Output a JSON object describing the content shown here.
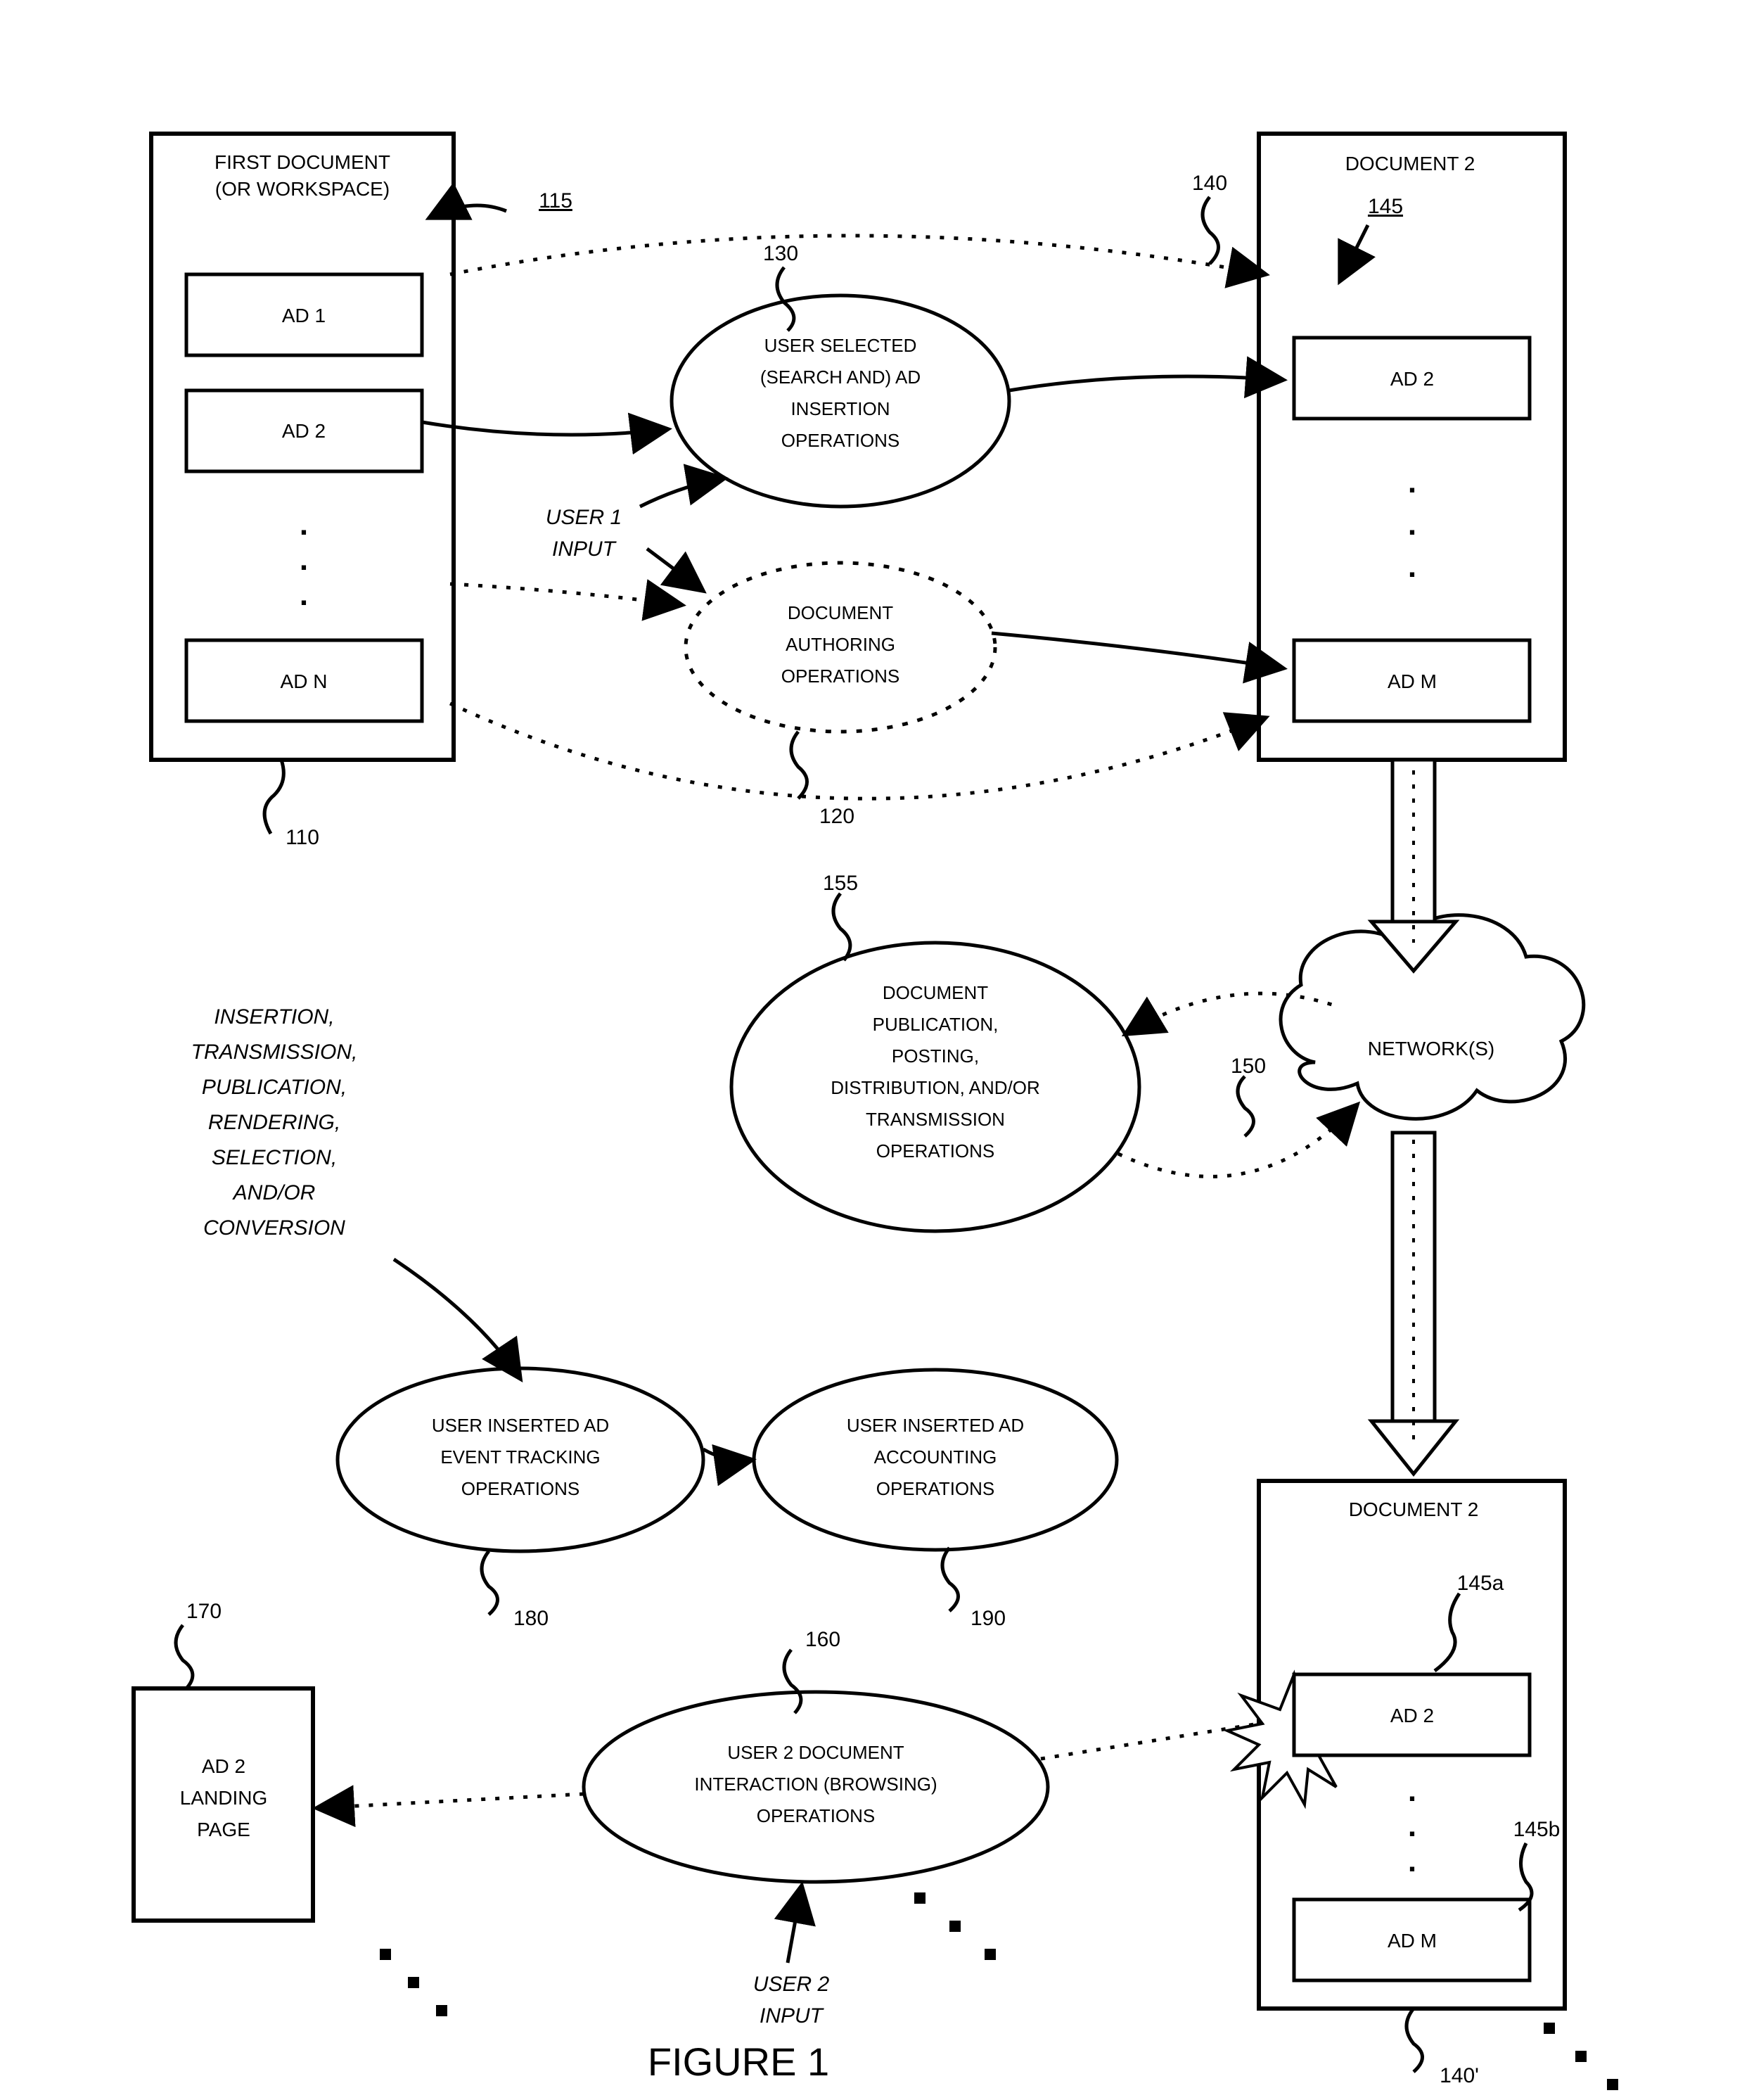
{
  "doc1": {
    "title1": "FIRST DOCUMENT",
    "title2": "(OR WORKSPACE)",
    "ad1": "AD 1",
    "ad2": "AD 2",
    "adn": "AD N",
    "ref": "110",
    "ref_inner": "115"
  },
  "doc2a": {
    "title": "DOCUMENT 2",
    "ad2": "AD 2",
    "adm": "AD M",
    "ref": "140",
    "ref_inner": "145"
  },
  "doc2b": {
    "title": "DOCUMENT 2",
    "ad2": "AD 2",
    "adm": "AD M",
    "ref": "140'",
    "ref_a": "145a",
    "ref_b": "145b"
  },
  "op_insert": {
    "l1": "USER SELECTED",
    "l2": "(SEARCH AND) AD",
    "l3": "INSERTION",
    "l4": "OPERATIONS",
    "ref": "130"
  },
  "op_author": {
    "l1": "DOCUMENT",
    "l2": "AUTHORING",
    "l3": "OPERATIONS",
    "ref": "120"
  },
  "op_pub": {
    "l1": "DOCUMENT",
    "l2": "PUBLICATION,",
    "l3": "POSTING,",
    "l4": "DISTRIBUTION,  AND/OR",
    "l5": "TRANSMISSION",
    "l6": "OPERATIONS",
    "ref": "155"
  },
  "op_track": {
    "l1": "USER INSERTED AD",
    "l2": "EVENT TRACKING",
    "l3": "OPERATIONS",
    "ref": "180"
  },
  "op_acct": {
    "l1": "USER INSERTED AD",
    "l2": "ACCOUNTING",
    "l3": "OPERATIONS",
    "ref": "190"
  },
  "op_browse": {
    "l1": "USER 2 DOCUMENT",
    "l2": "INTERACTION (BROWSING)",
    "l3": "OPERATIONS",
    "ref": "160"
  },
  "landing": {
    "l1": "AD 2",
    "l2": "LANDING",
    "l3": "PAGE",
    "ref": "170"
  },
  "network": {
    "label": "NETWORK(S)",
    "ref": "150"
  },
  "user1": "USER 1",
  "input": "INPUT",
  "user2": "USER 2",
  "annotation": {
    "l1": "INSERTION,",
    "l2": "TRANSMISSION,",
    "l3": "PUBLICATION,",
    "l4": "RENDERING,",
    "l5": "SELECTION,",
    "l6": "AND/OR",
    "l7": "CONVERSION"
  },
  "figure": "FIGURE 1"
}
